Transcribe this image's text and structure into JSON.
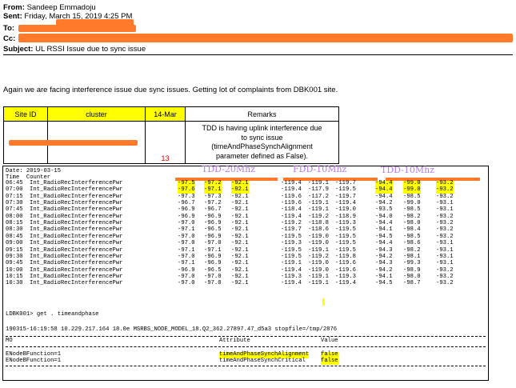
{
  "email": {
    "from_label": "From:",
    "from_value": "Sandeep Emmadoju",
    "sent_label": "Sent:",
    "sent_value": "Friday, March 15, 2019 4:25 PM",
    "to_label": "To:",
    "cc_label": "Cc:",
    "subject_label": "Subject:",
    "subject_value": "UL RSSI Issue due to sync issue",
    "body": "Again we are facing interference issue due sync issues. Getting lot of complaints from DBK001 site."
  },
  "site_table": {
    "headers": [
      "Site ID",
      "cluster",
      "14-Mar",
      "Remarks"
    ],
    "value_14mar": "13",
    "remarks_lines": [
      "TDD is having uplink interference due",
      "to sync issue",
      "(timeAndPhaseSynchAlignment",
      "parameter defined as False)."
    ]
  },
  "terminal": {
    "date_line": "Date: 2019-03-15",
    "col_header": "Time  Counter",
    "annotations": [
      "TDD-20Mhz",
      "FDD-10Mhz",
      "TDD-10Mhz"
    ],
    "counter": "Int_RadioRecInterferencePwr",
    "rows": [
      {
        "time": "06:45",
        "v": [
          "-97.5",
          "-97.2",
          "-92.1",
          "-119.4",
          "-119.1",
          "-119.7",
          "-94.4",
          "-99.0",
          "-93.2"
        ]
      },
      {
        "time": "07:00",
        "v": [
          "-97.6",
          "-97.1",
          "-92.1",
          "-119.4",
          "-117.9",
          "-119.5",
          "-94.4",
          "-99.0",
          "-93.2"
        ]
      },
      {
        "time": "07:15",
        "v": [
          "-97.3",
          "-97.3",
          "-92.1",
          "-119.6",
          "-117.2",
          "-119.7",
          "-94.4",
          "-98.5",
          "-93.2"
        ]
      },
      {
        "time": "07:30",
        "v": [
          "-96.7",
          "-97.2",
          "-92.1",
          "-119.6",
          "-119.1",
          "-119.4",
          "-94.2",
          "-99.0",
          "-93.1"
        ]
      },
      {
        "time": "07:45",
        "v": [
          "-96.9",
          "-96.7",
          "-92.1",
          "-118.4",
          "-119.1",
          "-119.0",
          "-93.5",
          "-98.5",
          "-93.1"
        ]
      },
      {
        "time": "08:00",
        "v": [
          "-96.9",
          "-96.9",
          "-92.1",
          "-119.4",
          "-119.2",
          "-118.9",
          "-94.0",
          "-98.2",
          "-93.2"
        ]
      },
      {
        "time": "08:15",
        "v": [
          "-97.0",
          "-96.9",
          "-92.1",
          "-119.2",
          "-118.8",
          "-119.3",
          "-94.4",
          "-98.0",
          "-93.2"
        ]
      },
      {
        "time": "08:30",
        "v": [
          "-97.1",
          "-96.5",
          "-92.1",
          "-119.7",
          "-118.6",
          "-119.5",
          "-94.1",
          "-98.4",
          "-93.2"
        ]
      },
      {
        "time": "08:45",
        "v": [
          "-97.0",
          "-96.9",
          "-92.1",
          "-119.5",
          "-119.0",
          "-119.5",
          "-94.5",
          "-98.5",
          "-93.2"
        ]
      },
      {
        "time": "09:00",
        "v": [
          "-97.0",
          "-97.0",
          "-92.1",
          "-119.3",
          "-119.0",
          "-119.5",
          "-94.4",
          "-98.6",
          "-93.1"
        ]
      },
      {
        "time": "09:15",
        "v": [
          "-97.1",
          "-97.1",
          "-92.1",
          "-119.5",
          "-119.1",
          "-119.5",
          "-94.3",
          "-98.2",
          "-93.1"
        ]
      },
      {
        "time": "09:30",
        "v": [
          "-97.0",
          "-96.9",
          "-92.1",
          "-119.5",
          "-119.2",
          "-119.8",
          "-94.2",
          "-98.1",
          "-93.1"
        ]
      },
      {
        "time": "09:45",
        "v": [
          "-97.1",
          "-96.9",
          "-92.1",
          "-119.1",
          "-119.0",
          "-119.6",
          "-94.3",
          "-99.3",
          "-93.1"
        ]
      },
      {
        "time": "10:00",
        "v": [
          "-96.9",
          "-96.5",
          "-92.1",
          "-119.4",
          "-119.0",
          "-119.6",
          "-94.2",
          "-98.9",
          "-93.2"
        ]
      },
      {
        "time": "10:15",
        "v": [
          "-97.0",
          "-97.0",
          "-92.1",
          "-119.3",
          "-119.1",
          "-119.3",
          "-94.1",
          "-98.0",
          "-93.2"
        ]
      },
      {
        "time": "10:30",
        "v": [
          "-97.0",
          "-97.0",
          "-92.1",
          "-119.4",
          "-119.1",
          "-119.4",
          "-94.5",
          "-98.7",
          "-93.2"
        ]
      }
    ],
    "command": "LDBK001> get . timeandphase",
    "status_line": "190315-16:19:58 10.229.217.164 18.0e MSRBS_NODE_MODEL_18.Q2_362.27897.47_d5a3 stopfile=/tmp/2876",
    "table_header": {
      "mo": "MO",
      "attr": "Attribute",
      "value": "Value"
    },
    "attr_rows": [
      {
        "mo": "ENodeBFunction=1",
        "attr": "timeAndPhaseSynchAlignment",
        "value": "false"
      },
      {
        "mo": "ENodeBFunction=1",
        "attr": "timeAndPhaseSynchCritical",
        "value": "false"
      }
    ]
  },
  "colors": {
    "highlight": "#ffff00",
    "redaction": "#ff7a2a",
    "annotation": "#b57be6"
  }
}
